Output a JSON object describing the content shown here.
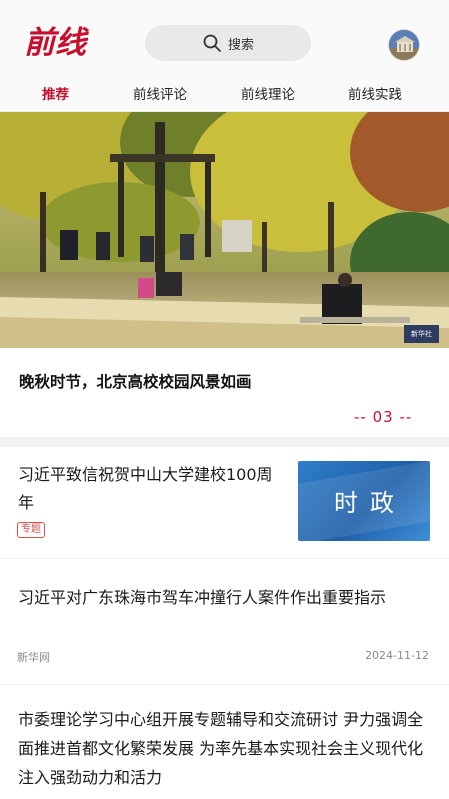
{
  "header": {
    "logo_text": "前线",
    "search_label": "搜索"
  },
  "tabs": [
    {
      "label": "推荐",
      "active": true
    },
    {
      "label": "前线评论",
      "active": false
    },
    {
      "label": "前线理论",
      "active": false
    },
    {
      "label": "前线实践",
      "active": false
    }
  ],
  "carousel": {
    "caption": "晚秋时节，北京高校校园风景如画",
    "page_indicator": "-- 03 --",
    "watermark": "新华社"
  },
  "news": [
    {
      "title": "习近平致信祝贺中山大学建校100周年",
      "tag": "专题",
      "thumbnail_text": "时政"
    },
    {
      "title": "习近平对广东珠海市驾车冲撞行人案件作出重要指示",
      "source": "新华网",
      "date": "2024-11-12"
    },
    {
      "title": "市委理论学习中心组开展专题辅导和交流研讨 尹力强调全面推进首都文化繁荣发展 为率先基本实现社会主义现代化注入强劲动力和活力"
    }
  ],
  "colors": {
    "accent": "#c8102e",
    "search_bg": "#e9e9e9",
    "thumbnail_blue": "#2f7ec9"
  }
}
